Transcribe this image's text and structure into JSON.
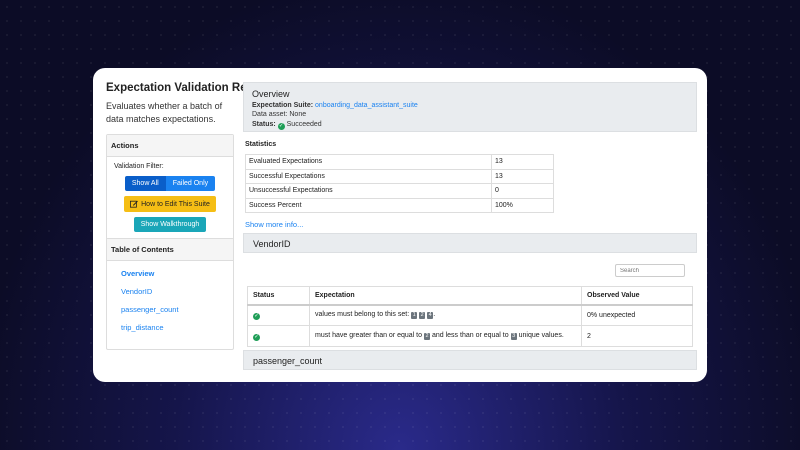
{
  "header": {
    "title": "Expectation Validation Result",
    "subtitle": "Evaluates whether a batch of data matches expectations."
  },
  "actions": {
    "heading": "Actions",
    "filter_label": "Validation Filter:",
    "show_all": "Show All",
    "failed_only": "Failed Only",
    "edit_suite": "How to Edit This Suite",
    "walkthrough": "Show Walkthrough"
  },
  "toc": {
    "heading": "Table of Contents",
    "items": [
      "Overview",
      "VendorID",
      "passenger_count",
      "trip_distance"
    ]
  },
  "overview": {
    "title": "Overview",
    "suite_label": "Expectation Suite:",
    "suite_value": "onboarding_data_assistant_suite",
    "asset_label": "Data asset:",
    "asset_value": "None",
    "status_label": "Status:",
    "status_value": "Succeeded"
  },
  "statistics": {
    "title": "Statistics",
    "rows": [
      {
        "label": "Evaluated Expectations",
        "value": "13"
      },
      {
        "label": "Successful Expectations",
        "value": "13"
      },
      {
        "label": "Unsuccessful Expectations",
        "value": "0"
      },
      {
        "label": "Success Percent",
        "value": "100%"
      }
    ],
    "more": "Show more info..."
  },
  "vendor": {
    "title": "VendorID",
    "search_placeholder": "Search",
    "columns": [
      "Status",
      "Expectation",
      "Observed Value"
    ],
    "row1": {
      "text_before": "values must belong to this set:",
      "badges": [
        "1",
        "2",
        "4"
      ],
      "text_after": ".",
      "observed": "0% unexpected"
    },
    "row2": {
      "text1": "must have greater than or equal to",
      "badge1": "2",
      "text2": "and less than or equal to",
      "badge2": "3",
      "text3": "unique values.",
      "observed": "2"
    }
  },
  "passenger": {
    "title": "passenger_count"
  },
  "colors": {
    "accent": "#1a82f0",
    "success": "#1f9e57",
    "warning": "#f5be15",
    "info": "#1aa6b8"
  },
  "icons": {
    "status": "check-circle-icon",
    "edit": "edit-icon"
  }
}
